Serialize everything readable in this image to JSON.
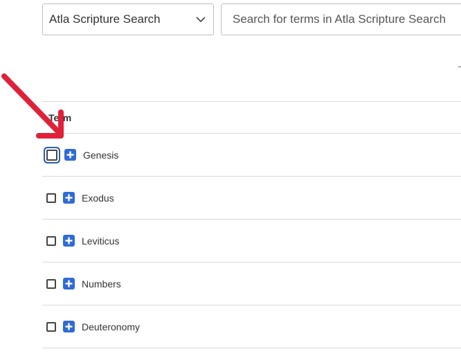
{
  "search": {
    "database_selected": "Atla Scripture Search",
    "placeholder": "Search for terms in Atla Scripture Search",
    "value": ""
  },
  "table": {
    "header": "Term",
    "rows": [
      {
        "term": "Genesis",
        "checked": false,
        "focused": true
      },
      {
        "term": "Exodus",
        "checked": false,
        "focused": false
      },
      {
        "term": "Leviticus",
        "checked": false,
        "focused": false
      },
      {
        "term": "Numbers",
        "checked": false,
        "focused": false
      },
      {
        "term": "Deuteronomy",
        "checked": false,
        "focused": false
      }
    ]
  },
  "icons": {
    "dropdown": "chevron-down-icon",
    "expand": "plus-icon",
    "annotation": "red-arrow-icon"
  },
  "colors": {
    "expand_icon": "#2f6bd6",
    "focus_ring": "#2a5db0",
    "annotation_arrow": "#e0213a"
  }
}
